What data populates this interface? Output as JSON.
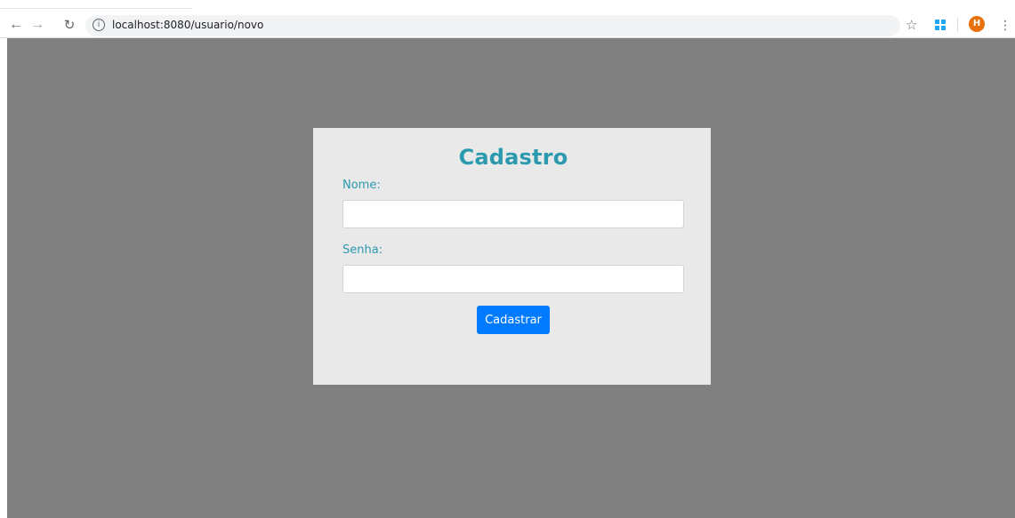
{
  "browser": {
    "url": "localhost:8080/usuario/novo",
    "back_icon": "arrow-left-icon",
    "forward_icon": "arrow-right-icon",
    "reload_icon": "reload-icon",
    "info_icon": "info-icon",
    "bookmark_icon": "star-icon",
    "extension_icon": "windows-icon",
    "profile_initial": "H",
    "profile_color": "#e8710a",
    "menu_icon": "more-vertical-icon"
  },
  "form": {
    "title": "Cadastro",
    "nome_label": "Nome:",
    "nome_value": "",
    "senha_label": "Senha:",
    "senha_value": "",
    "submit_label": "Cadastrar"
  },
  "colors": {
    "background": "#808080",
    "card": "#e9e9e9",
    "accent": "#2b9aae",
    "button": "#007bff"
  }
}
